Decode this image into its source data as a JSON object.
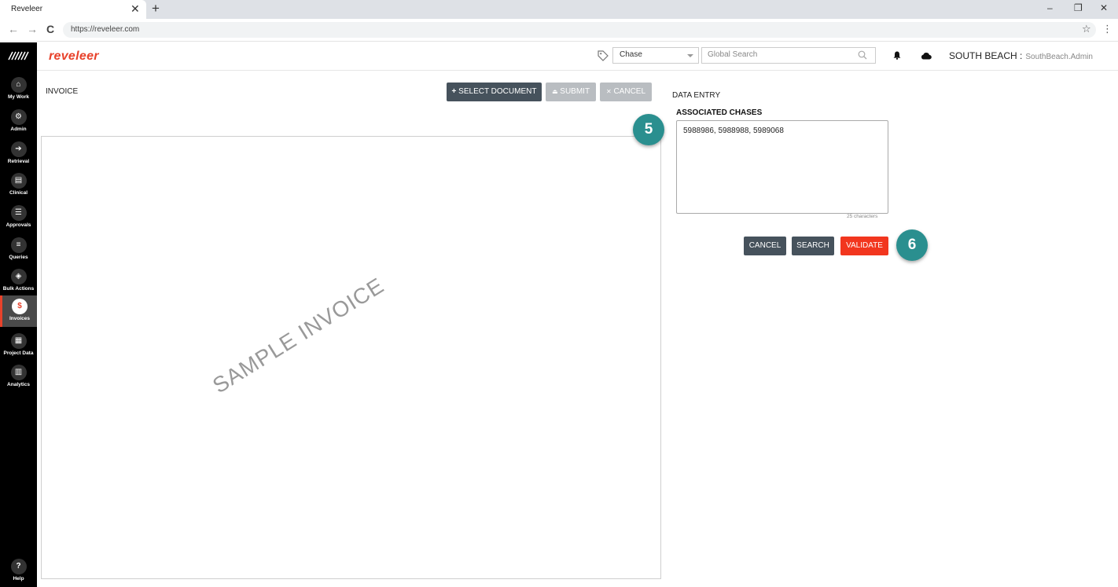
{
  "browser": {
    "tab_title": "Reveleer",
    "tab_close": "✕",
    "new_tab": "+",
    "url": "https://reveleer.com",
    "back": "←",
    "forward": "→",
    "reload": "C",
    "star": "☆",
    "menu": "⋮",
    "minimize": "–",
    "restore": "❐",
    "close": "✕"
  },
  "app": {
    "logo": "reveleer",
    "chase_select": "Chase",
    "global_search_placeholder": "Global Search",
    "org_name": "SOUTH BEACH :",
    "org_user": "SouthBeach.Admin"
  },
  "sidebar": {
    "items": [
      {
        "label": "My Work",
        "icon": "home-icon"
      },
      {
        "label": "Admin",
        "icon": "gear-icon"
      },
      {
        "label": "Retrieval",
        "icon": "arrow-right-icon"
      },
      {
        "label": "Clinical",
        "icon": "document-icon"
      },
      {
        "label": "Approvals",
        "icon": "checklist-icon"
      },
      {
        "label": "Queries",
        "icon": "list-icon"
      },
      {
        "label": "Bulk Actions",
        "icon": "layers-icon"
      },
      {
        "label": "Invoices",
        "icon": "dollar-icon",
        "active": true
      },
      {
        "label": "Project Data",
        "icon": "table-icon"
      },
      {
        "label": "Analytics",
        "icon": "bar-chart-icon"
      }
    ],
    "help": {
      "label": "Help",
      "icon": "help-icon"
    }
  },
  "invoice": {
    "title": "INVOICE",
    "select_document": "SELECT DOCUMENT",
    "submit": "SUBMIT",
    "cancel": "CANCEL",
    "watermark": "SAMPLE INVOICE"
  },
  "data_entry": {
    "title": "DATA ENTRY",
    "associated_chases_label": "ASSOCIATED CHASES",
    "associated_chases_value": "5988986, 5988988, 5989068",
    "char_count": "25 characters",
    "cancel": "CANCEL",
    "search": "SEARCH",
    "validate": "VALIDATE"
  },
  "callouts": {
    "step5": "5",
    "step6": "6"
  },
  "colors": {
    "brand": "#e8422b",
    "dark_button": "#46525c",
    "validate": "#f2361e",
    "badge": "#2a8f8f"
  }
}
